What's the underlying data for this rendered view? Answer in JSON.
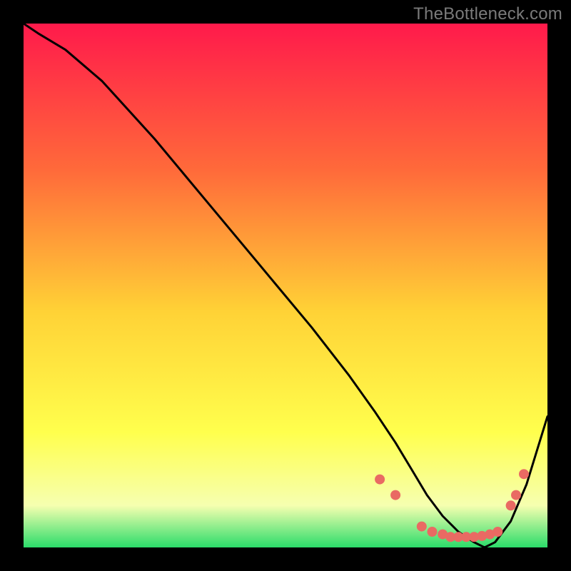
{
  "watermark": "TheBottleneck.com",
  "colors": {
    "gradient_top": "#ff1a4b",
    "gradient_mid_upper": "#ff6a3a",
    "gradient_mid": "#ffd236",
    "gradient_mid_lower": "#ffff4d",
    "gradient_lower": "#f6ffb0",
    "gradient_bottom": "#2bdc6a",
    "curve": "#000000",
    "dots": "#e96a63",
    "frame": "#000000"
  },
  "chart_data": {
    "type": "line",
    "title": "",
    "xlabel": "",
    "ylabel": "",
    "xlim": [
      0,
      100
    ],
    "ylim": [
      0,
      100
    ],
    "series": [
      {
        "name": "curve",
        "x": [
          0,
          3,
          8,
          15,
          25,
          35,
          45,
          55,
          62,
          67,
          71,
          74,
          77,
          80,
          83,
          86,
          88,
          90,
          93,
          96,
          100
        ],
        "y": [
          100,
          98,
          95,
          89,
          78,
          66,
          54,
          42,
          33,
          26,
          20,
          15,
          10,
          6,
          3,
          1,
          0,
          1,
          5,
          12,
          25
        ]
      }
    ],
    "dots": {
      "name": "markers",
      "points": [
        {
          "x": 68,
          "y": 13
        },
        {
          "x": 71,
          "y": 10
        },
        {
          "x": 76,
          "y": 4
        },
        {
          "x": 78,
          "y": 3
        },
        {
          "x": 80,
          "y": 2.5
        },
        {
          "x": 81.5,
          "y": 2
        },
        {
          "x": 83,
          "y": 2
        },
        {
          "x": 84.5,
          "y": 2
        },
        {
          "x": 86,
          "y": 2
        },
        {
          "x": 87.5,
          "y": 2.2
        },
        {
          "x": 89,
          "y": 2.5
        },
        {
          "x": 90.5,
          "y": 3
        },
        {
          "x": 93,
          "y": 8
        },
        {
          "x": 94,
          "y": 10
        },
        {
          "x": 95.5,
          "y": 14
        }
      ]
    }
  }
}
